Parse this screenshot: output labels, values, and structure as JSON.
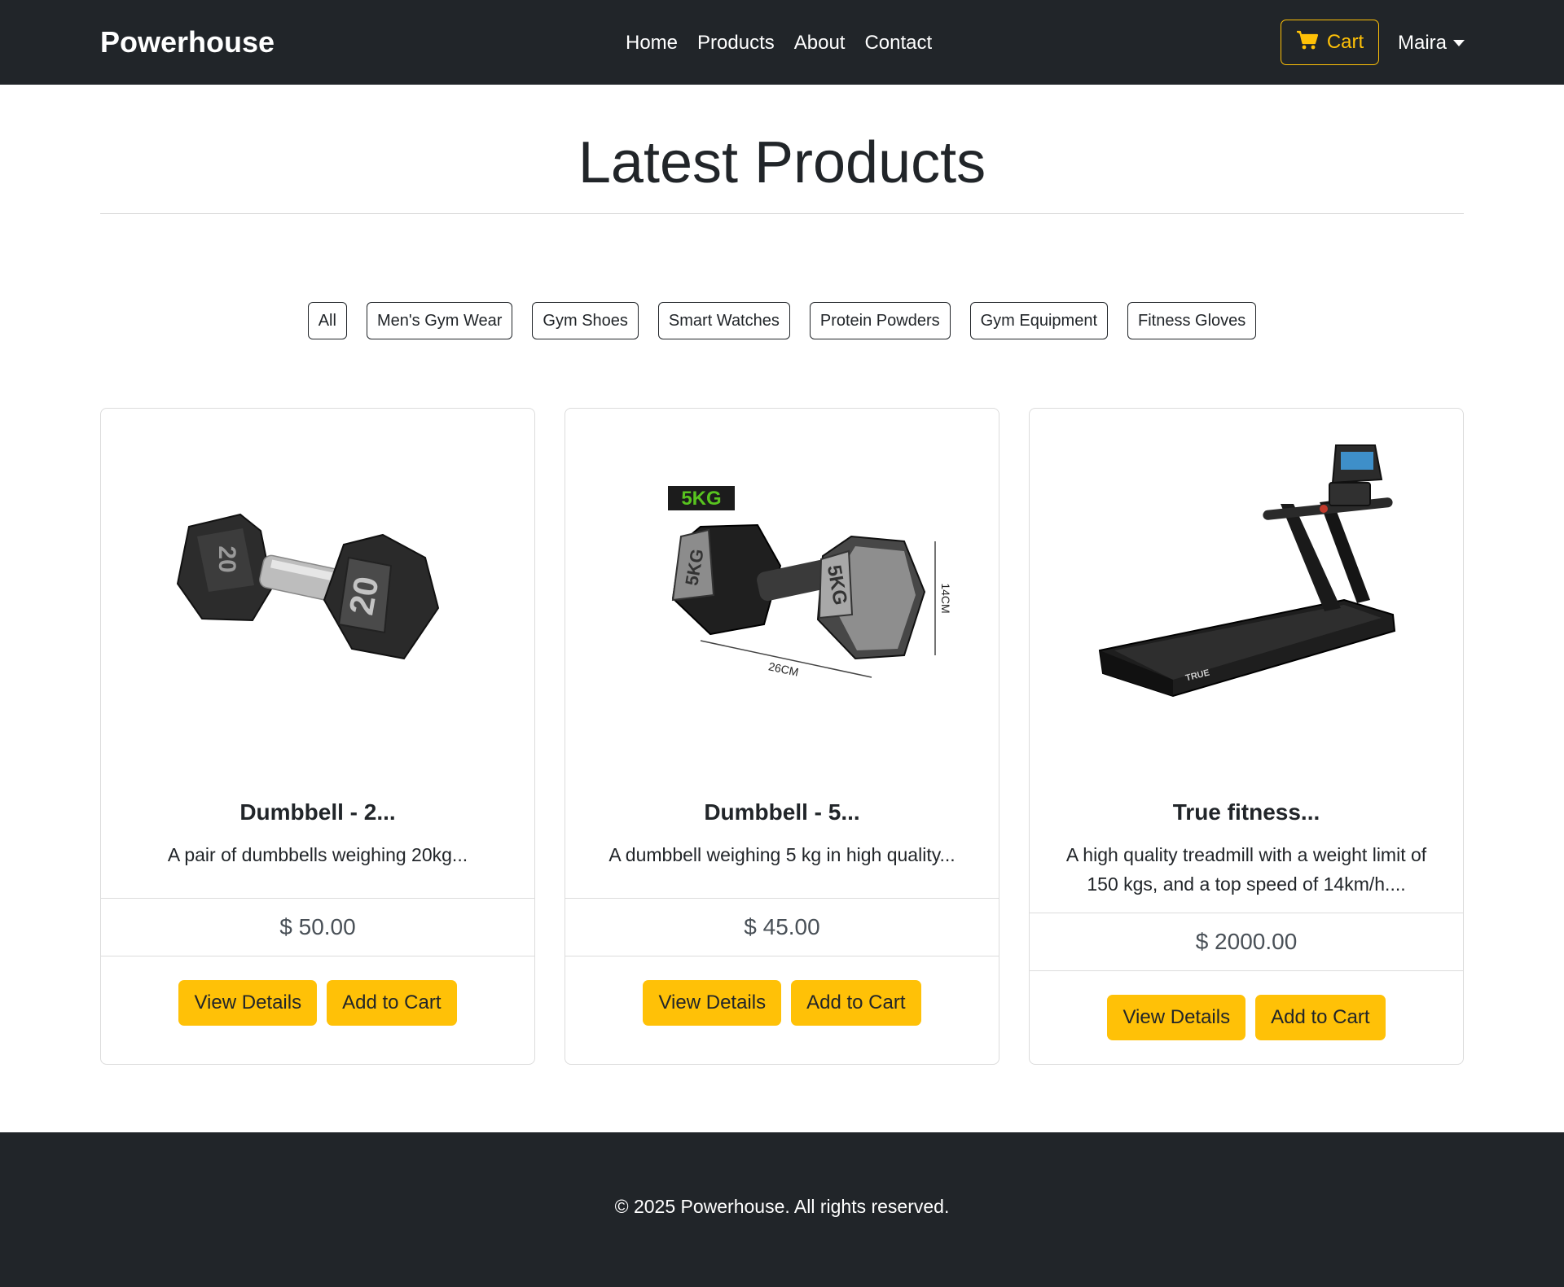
{
  "navbar": {
    "brand": "Powerhouse",
    "links": [
      "Home",
      "Products",
      "About",
      "Contact"
    ],
    "cart_label": "Cart",
    "user_name": "Maira"
  },
  "page": {
    "title": "Latest Products"
  },
  "filters": [
    "All",
    "Men's Gym Wear",
    "Gym Shoes",
    "Smart Watches",
    "Protein Powders",
    "Gym Equipment",
    "Fitness Gloves"
  ],
  "products": [
    {
      "name": "Dumbbell - 2...",
      "description": "A pair of dumbbells weighing 20kg...",
      "price": "$ 50.00",
      "image_labels": [
        "20",
        "20"
      ],
      "view_label": "View Details",
      "add_label": "Add to Cart"
    },
    {
      "name": "Dumbbell - 5...",
      "description": "A dumbbell weighing 5 kg in high quality...",
      "price": "$ 45.00",
      "image_labels": [
        "5KG",
        "5KG",
        "5KG",
        "14CM",
        "26CM"
      ],
      "view_label": "View Details",
      "add_label": "Add to Cart"
    },
    {
      "name": "True fitness...",
      "description": "A high quality treadmill with a weight limit of 150 kgs, and a top speed of 14km/h....",
      "price": "$ 2000.00",
      "image_labels": [
        "TRUE"
      ],
      "view_label": "View Details",
      "add_label": "Add to Cart"
    }
  ],
  "footer": {
    "text": "© 2025 Powerhouse. All rights reserved."
  },
  "colors": {
    "navbar_bg": "#212529",
    "accent": "#ffc107",
    "text": "#212529",
    "price_text": "#495057"
  },
  "icons": {
    "cart": "shopping-cart-icon",
    "user_dropdown": "caret-down-icon"
  }
}
